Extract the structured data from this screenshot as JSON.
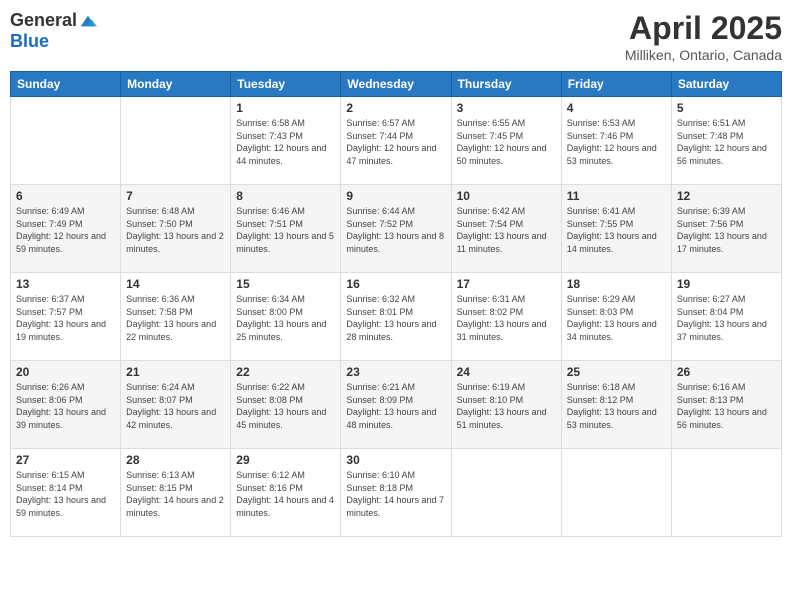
{
  "logo": {
    "general": "General",
    "blue": "Blue"
  },
  "header": {
    "title": "April 2025",
    "subtitle": "Milliken, Ontario, Canada"
  },
  "weekdays": [
    "Sunday",
    "Monday",
    "Tuesday",
    "Wednesday",
    "Thursday",
    "Friday",
    "Saturday"
  ],
  "weeks": [
    [
      {
        "day": "",
        "sunrise": "",
        "sunset": "",
        "daylight": ""
      },
      {
        "day": "",
        "sunrise": "",
        "sunset": "",
        "daylight": ""
      },
      {
        "day": "1",
        "sunrise": "Sunrise: 6:58 AM",
        "sunset": "Sunset: 7:43 PM",
        "daylight": "Daylight: 12 hours and 44 minutes."
      },
      {
        "day": "2",
        "sunrise": "Sunrise: 6:57 AM",
        "sunset": "Sunset: 7:44 PM",
        "daylight": "Daylight: 12 hours and 47 minutes."
      },
      {
        "day": "3",
        "sunrise": "Sunrise: 6:55 AM",
        "sunset": "Sunset: 7:45 PM",
        "daylight": "Daylight: 12 hours and 50 minutes."
      },
      {
        "day": "4",
        "sunrise": "Sunrise: 6:53 AM",
        "sunset": "Sunset: 7:46 PM",
        "daylight": "Daylight: 12 hours and 53 minutes."
      },
      {
        "day": "5",
        "sunrise": "Sunrise: 6:51 AM",
        "sunset": "Sunset: 7:48 PM",
        "daylight": "Daylight: 12 hours and 56 minutes."
      }
    ],
    [
      {
        "day": "6",
        "sunrise": "Sunrise: 6:49 AM",
        "sunset": "Sunset: 7:49 PM",
        "daylight": "Daylight: 12 hours and 59 minutes."
      },
      {
        "day": "7",
        "sunrise": "Sunrise: 6:48 AM",
        "sunset": "Sunset: 7:50 PM",
        "daylight": "Daylight: 13 hours and 2 minutes."
      },
      {
        "day": "8",
        "sunrise": "Sunrise: 6:46 AM",
        "sunset": "Sunset: 7:51 PM",
        "daylight": "Daylight: 13 hours and 5 minutes."
      },
      {
        "day": "9",
        "sunrise": "Sunrise: 6:44 AM",
        "sunset": "Sunset: 7:52 PM",
        "daylight": "Daylight: 13 hours and 8 minutes."
      },
      {
        "day": "10",
        "sunrise": "Sunrise: 6:42 AM",
        "sunset": "Sunset: 7:54 PM",
        "daylight": "Daylight: 13 hours and 11 minutes."
      },
      {
        "day": "11",
        "sunrise": "Sunrise: 6:41 AM",
        "sunset": "Sunset: 7:55 PM",
        "daylight": "Daylight: 13 hours and 14 minutes."
      },
      {
        "day": "12",
        "sunrise": "Sunrise: 6:39 AM",
        "sunset": "Sunset: 7:56 PM",
        "daylight": "Daylight: 13 hours and 17 minutes."
      }
    ],
    [
      {
        "day": "13",
        "sunrise": "Sunrise: 6:37 AM",
        "sunset": "Sunset: 7:57 PM",
        "daylight": "Daylight: 13 hours and 19 minutes."
      },
      {
        "day": "14",
        "sunrise": "Sunrise: 6:36 AM",
        "sunset": "Sunset: 7:58 PM",
        "daylight": "Daylight: 13 hours and 22 minutes."
      },
      {
        "day": "15",
        "sunrise": "Sunrise: 6:34 AM",
        "sunset": "Sunset: 8:00 PM",
        "daylight": "Daylight: 13 hours and 25 minutes."
      },
      {
        "day": "16",
        "sunrise": "Sunrise: 6:32 AM",
        "sunset": "Sunset: 8:01 PM",
        "daylight": "Daylight: 13 hours and 28 minutes."
      },
      {
        "day": "17",
        "sunrise": "Sunrise: 6:31 AM",
        "sunset": "Sunset: 8:02 PM",
        "daylight": "Daylight: 13 hours and 31 minutes."
      },
      {
        "day": "18",
        "sunrise": "Sunrise: 6:29 AM",
        "sunset": "Sunset: 8:03 PM",
        "daylight": "Daylight: 13 hours and 34 minutes."
      },
      {
        "day": "19",
        "sunrise": "Sunrise: 6:27 AM",
        "sunset": "Sunset: 8:04 PM",
        "daylight": "Daylight: 13 hours and 37 minutes."
      }
    ],
    [
      {
        "day": "20",
        "sunrise": "Sunrise: 6:26 AM",
        "sunset": "Sunset: 8:06 PM",
        "daylight": "Daylight: 13 hours and 39 minutes."
      },
      {
        "day": "21",
        "sunrise": "Sunrise: 6:24 AM",
        "sunset": "Sunset: 8:07 PM",
        "daylight": "Daylight: 13 hours and 42 minutes."
      },
      {
        "day": "22",
        "sunrise": "Sunrise: 6:22 AM",
        "sunset": "Sunset: 8:08 PM",
        "daylight": "Daylight: 13 hours and 45 minutes."
      },
      {
        "day": "23",
        "sunrise": "Sunrise: 6:21 AM",
        "sunset": "Sunset: 8:09 PM",
        "daylight": "Daylight: 13 hours and 48 minutes."
      },
      {
        "day": "24",
        "sunrise": "Sunrise: 6:19 AM",
        "sunset": "Sunset: 8:10 PM",
        "daylight": "Daylight: 13 hours and 51 minutes."
      },
      {
        "day": "25",
        "sunrise": "Sunrise: 6:18 AM",
        "sunset": "Sunset: 8:12 PM",
        "daylight": "Daylight: 13 hours and 53 minutes."
      },
      {
        "day": "26",
        "sunrise": "Sunrise: 6:16 AM",
        "sunset": "Sunset: 8:13 PM",
        "daylight": "Daylight: 13 hours and 56 minutes."
      }
    ],
    [
      {
        "day": "27",
        "sunrise": "Sunrise: 6:15 AM",
        "sunset": "Sunset: 8:14 PM",
        "daylight": "Daylight: 13 hours and 59 minutes."
      },
      {
        "day": "28",
        "sunrise": "Sunrise: 6:13 AM",
        "sunset": "Sunset: 8:15 PM",
        "daylight": "Daylight: 14 hours and 2 minutes."
      },
      {
        "day": "29",
        "sunrise": "Sunrise: 6:12 AM",
        "sunset": "Sunset: 8:16 PM",
        "daylight": "Daylight: 14 hours and 4 minutes."
      },
      {
        "day": "30",
        "sunrise": "Sunrise: 6:10 AM",
        "sunset": "Sunset: 8:18 PM",
        "daylight": "Daylight: 14 hours and 7 minutes."
      },
      {
        "day": "",
        "sunrise": "",
        "sunset": "",
        "daylight": ""
      },
      {
        "day": "",
        "sunrise": "",
        "sunset": "",
        "daylight": ""
      },
      {
        "day": "",
        "sunrise": "",
        "sunset": "",
        "daylight": ""
      }
    ]
  ]
}
